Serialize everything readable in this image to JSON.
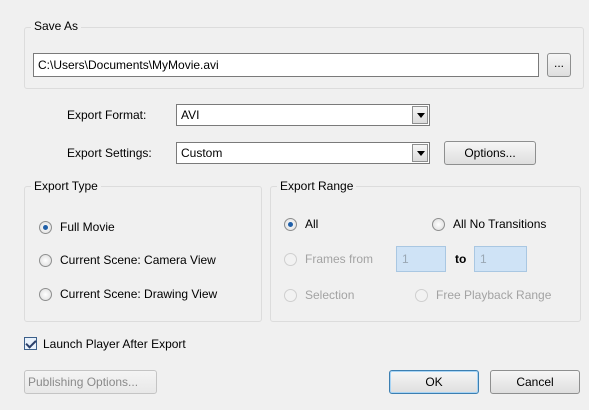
{
  "save_as": {
    "title": "Save As",
    "path": "C:\\Users\\Documents\\MyMovie.avi",
    "browse_label": "..."
  },
  "export_format": {
    "label": "Export Format:",
    "value": "AVI"
  },
  "export_settings": {
    "label": "Export Settings:",
    "value": "Custom",
    "options_button": "Options..."
  },
  "export_type": {
    "title": "Export Type",
    "options": [
      "Full Movie",
      "Current Scene: Camera View",
      "Current Scene: Drawing View"
    ],
    "selected": "Full Movie"
  },
  "export_range": {
    "title": "Export Range",
    "all": "All",
    "all_no_transitions": "All No Transitions",
    "frames_from": "Frames from",
    "from_value": "1",
    "to_label": "to",
    "to_value": "1",
    "selection": "Selection",
    "free_playback_range": "Free Playback Range"
  },
  "launch_player": {
    "label": "Launch Player After Export",
    "checked": true
  },
  "buttons": {
    "publishing_options": "Publishing Options...",
    "ok": "OK",
    "cancel": "Cancel"
  }
}
